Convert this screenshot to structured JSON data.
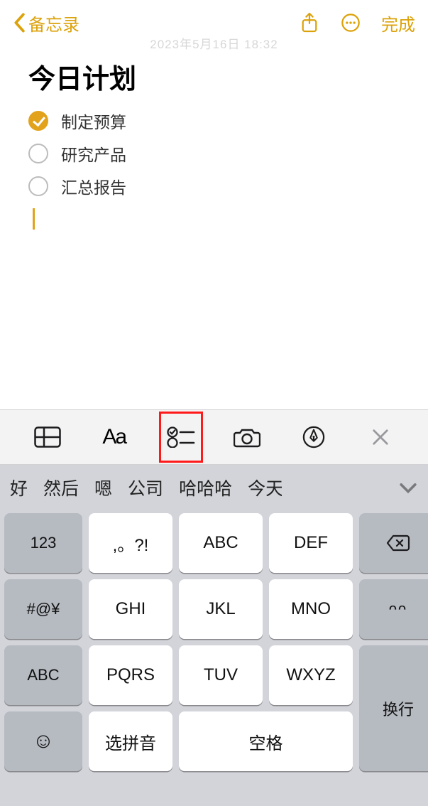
{
  "nav": {
    "back": "备忘录",
    "done": "完成"
  },
  "timestamp": "2023年5月16日 18:32",
  "note": {
    "title": "今日计划",
    "items": [
      {
        "text": "制定预算",
        "checked": true
      },
      {
        "text": "研究产品",
        "checked": false
      },
      {
        "text": "汇总报告",
        "checked": false
      }
    ]
  },
  "fmtbar": {
    "icons": [
      "table-icon",
      "textformat-icon",
      "checklist-icon",
      "camera-icon",
      "pen-tip-icon",
      "close-icon"
    ],
    "Aa": "Aa"
  },
  "keyboard": {
    "candidates": [
      "好",
      "然后",
      "嗯",
      "公司",
      "哈哈哈",
      "今天"
    ],
    "rows": [
      [
        "123",
        ",。?!",
        "ABC",
        "DEF",
        "⌫"
      ],
      [
        "#@¥",
        "GHI",
        "JKL",
        "MNO",
        "^^"
      ],
      [
        "ABC",
        "PQRS",
        "TUV",
        "WXYZ",
        "换行"
      ],
      [
        "😀",
        "选拼音",
        "空格"
      ]
    ],
    "select_pinyin": "选拼音",
    "space": "空格",
    "enter": "换行",
    "num": "123",
    "punct": ",。?!",
    "sym": "#@¥",
    "abc": "ABC",
    "caret": "^^",
    "face": "ᴖᴖ"
  }
}
